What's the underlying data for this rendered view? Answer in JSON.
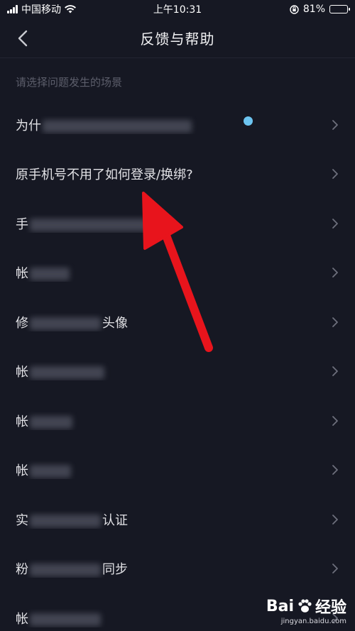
{
  "status_bar": {
    "carrier": "中国移动",
    "time": "上午10:31",
    "battery": "81%",
    "battery_level": 0.81
  },
  "nav": {
    "title": "反馈与帮助",
    "back_icon": "chevron-left-icon"
  },
  "section_label": "请选择问题发生的场景",
  "items": [
    {
      "prefix": "为什",
      "suffix": "",
      "has_dot": true
    },
    {
      "prefix": "原手机号不用了如何登录/换绑?",
      "suffix": ""
    },
    {
      "prefix": "手",
      "suffix": ""
    },
    {
      "prefix": "帐",
      "suffix": ""
    },
    {
      "prefix": "修",
      "suffix": "头像"
    },
    {
      "prefix": "帐",
      "suffix": ""
    },
    {
      "prefix": "帐",
      "suffix": ""
    },
    {
      "prefix": "帐",
      "suffix": ""
    },
    {
      "prefix": "实",
      "suffix": "认证"
    },
    {
      "prefix": "粉",
      "suffix": "同步"
    },
    {
      "prefix": "帐",
      "suffix": ""
    }
  ],
  "colors": {
    "background": "#161823",
    "notification_dot": "#6cc4f0",
    "annotation_arrow": "#e8141c"
  },
  "watermark": {
    "brand": "Bai",
    "brand_suffix": "经验",
    "url": "jingyan.baidu.com"
  }
}
